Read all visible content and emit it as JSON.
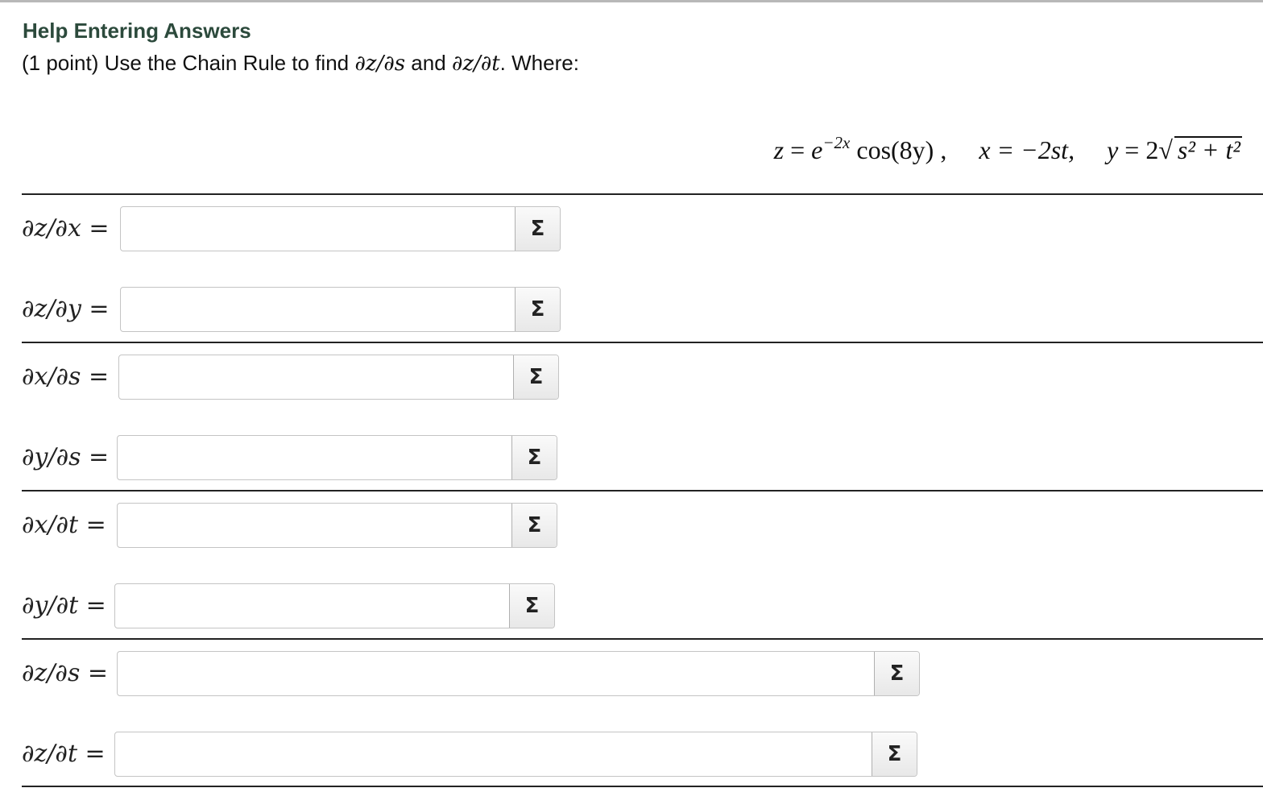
{
  "header": {
    "help_link": "Help Entering Answers",
    "problem_prefix": "(1 point) Use the Chain Rule to find ",
    "problem_d1": "∂z/∂s",
    "problem_and": " and ",
    "problem_d2": "∂z/∂t",
    "problem_suffix": ". Where:"
  },
  "equation": {
    "z_lhs": "z",
    "z_eq": " = ",
    "z_base": "e",
    "z_exp": "−2x",
    "z_rest": " cos(8y) ,",
    "x_lhs": "x",
    "x_rhs": " = −2st,",
    "y_lhs": "y",
    "y_eq": " = 2√",
    "y_radicand": "s² + t²"
  },
  "rows": [
    {
      "label": "∂z/∂x",
      "eq": " =",
      "value": ""
    },
    {
      "label": "∂z/∂y",
      "eq": " =",
      "value": ""
    },
    {
      "label": "∂x/∂s",
      "eq": " =",
      "value": ""
    },
    {
      "label": "∂y/∂s",
      "eq": " =",
      "value": ""
    },
    {
      "label": "∂x/∂t",
      "eq": " =",
      "value": ""
    },
    {
      "label": "∂y/∂t",
      "eq": " =",
      "value": ""
    },
    {
      "label": "∂z/∂s",
      "eq": " =",
      "value": ""
    },
    {
      "label": "∂z/∂t",
      "eq": " =",
      "value": ""
    }
  ],
  "equation_editor_button": "Σ"
}
